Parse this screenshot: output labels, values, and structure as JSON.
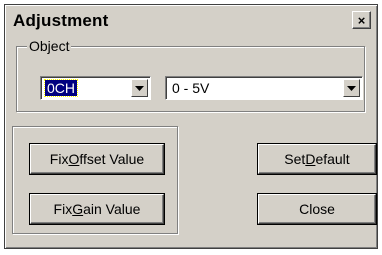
{
  "window": {
    "title": "Adjustment",
    "close_glyph": "×"
  },
  "object_group": {
    "legend": "Object",
    "channel": {
      "selected": "0CH"
    },
    "range": {
      "selected": "0 - 5V"
    }
  },
  "buttons": {
    "fix_offset": {
      "pre": "Fix ",
      "accel": "O",
      "post": "ffset Value"
    },
    "fix_gain": {
      "pre": "Fix ",
      "accel": "G",
      "post": "ain Value"
    },
    "set_default": {
      "pre": "Set ",
      "accel": "D",
      "post": "efault"
    },
    "close": {
      "label": "Close"
    }
  },
  "icons": {
    "dropdown_arrow": "chevron-down-icon"
  },
  "colors": {
    "face": "#d4d0c8",
    "selection": "#000080"
  }
}
